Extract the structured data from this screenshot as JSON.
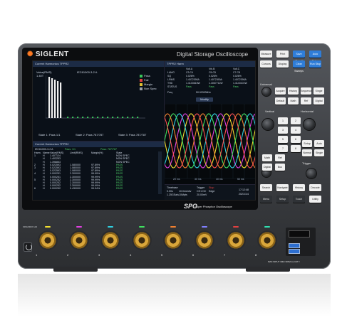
{
  "device": {
    "brand": "SIGLENT",
    "title": "Digital Storage Oscilloscope",
    "phosphor_logo": "SPO",
    "phosphor_sub": "Super Phosphor Oscilloscope",
    "model_label": "SDS2000X HD"
  },
  "screen": {
    "harmonics_panel_title": "Current Harmonics TPPR2",
    "bar_y_label": "Value(RMS)",
    "bar_y_value": "1.40T",
    "bar_chart_note": "IEC61000-3-2 A",
    "legend": [
      {
        "label": "Pass",
        "color": "#39c45a"
      },
      {
        "label": "Fail",
        "color": "#e04040"
      },
      {
        "label": "Margin",
        "color": "#e0c030"
      },
      {
        "label": "Non Spec",
        "color": "#9aa0a6"
      }
    ],
    "status": [
      "State 1: Pass 1/1",
      "State 2: Pass 787/787",
      "State 3: Pass 787/787"
    ],
    "meas_panel_title": "TPPR2 Harm",
    "meas_headers": [
      "",
      "Volt.A",
      "Vrk.B",
      "Volt.C"
    ],
    "meas_rows": [
      [
        "f.AMG",
        "C3.C4",
        "C5.C5",
        "C7.C8"
      ],
      [
        "SQ",
        "0.026%",
        "0.026%",
        "0.026%"
      ],
      [
        "I-RMS",
        "1.4072390A",
        "1.4072390A",
        "1.4072390A"
      ],
      [
        "THD",
        "1.4133616W",
        "1.4067711W",
        "1.4143101W"
      ],
      [
        "STATUS",
        "Pass",
        "Pass",
        "Pass"
      ]
    ],
    "freq_label": "Freq",
    "freq_value": "50.003036Hz",
    "modify_label": "Modify",
    "table_title": "Current Harmonics TPPR2",
    "table_sub": "IEC61000-3-2 A",
    "table_pass": "Pass: 1/1",
    "table_pass2": "Pass: 787/787",
    "table_headers": [
      "Harm.",
      "Name",
      "Value(RMS)",
      "Limit(RMS)",
      "Margin(%)",
      "State"
    ],
    "table_rows": [
      [
        "1",
        "H",
        "1.407124",
        "",
        "",
        "NON SPEC"
      ],
      [
        "",
        "H",
        "1.403253",
        "",
        "",
        "NON SPEC"
      ],
      [
        "",
        "H",
        "1.398853",
        "",
        "",
        "NON SPEC"
      ],
      [
        "2",
        "H",
        "0.022593",
        "1.080000",
        "97.89%",
        "PASS"
      ],
      [
        "3",
        "H",
        "0.022593",
        "1.080000",
        "97.89%",
        "PASS"
      ],
      [
        "",
        "H",
        "0.022593",
        "1.080000",
        "97.89%",
        "PASS"
      ],
      [
        "4",
        "H",
        "0.000251",
        "2.300000",
        "99.99%",
        "PASS"
      ],
      [
        "",
        "H",
        "0.000251",
        "2.300000",
        "99.99%",
        "PASS"
      ],
      [
        "5",
        "H",
        "0.000252",
        "2.300000",
        "99.99%",
        "PASS"
      ],
      [
        "",
        "H",
        "0.000252",
        "2.300000",
        "99.99%",
        "PASS"
      ],
      [
        "",
        "H",
        "0.000252",
        "2.300000",
        "99.99%",
        "PASS"
      ],
      [
        "6",
        "H",
        "0.000252",
        "0.430000",
        "99.94%",
        "PASS"
      ]
    ],
    "timebase_label": "Timebase",
    "timebase_value": "0.00s",
    "timebase_div": "10.0ms/div",
    "sample": "1.25GSa/s",
    "sample_pts": "10Mpts",
    "trigger_label": "Trigger",
    "trigger_state": "Stop",
    "trigger_val": "CH1 DC",
    "trigger_edge": "Edge",
    "trigger_level": "20.00mV",
    "time": "17:12:48",
    "date": "2021/1/4",
    "wave_ticks": [
      "20 ms",
      "30 ms",
      "40 ms",
      "50 ms"
    ]
  },
  "controls": {
    "row1": [
      "Measure",
      "Print",
      "Save Recall",
      "Auto Setup"
    ],
    "row2": [
      "Cursors",
      "Display",
      "Clear Sweeps",
      "Run Stop"
    ],
    "row3": [
      "Acquire",
      "History",
      "Sequence",
      "Single"
    ],
    "row4": [
      "Default",
      "Math",
      "Ref",
      "Digital"
    ],
    "vertical": "Vertical",
    "horizontal": "Horizontal",
    "universal": "Universal",
    "trigger_section": "Trigger",
    "channel_buttons": [
      "1",
      "2",
      "3",
      "4",
      "5",
      "6",
      "7",
      "8"
    ],
    "mid_buttons": [
      "Math",
      "Ref",
      "Digital",
      "Bus"
    ],
    "bottom_buttons": [
      "Search",
      "Navigate",
      "History",
      "Decode"
    ],
    "last_row": [
      "Menu",
      "Setup",
      "Touch",
      "Utility"
    ],
    "trigger_buttons": [
      "Setup",
      "Auto",
      "Normal",
      "Single"
    ]
  },
  "channels": [
    {
      "label": "1",
      "color": "#f2e030"
    },
    {
      "label": "2",
      "color": "#e040e0"
    },
    {
      "label": "3",
      "color": "#30d0e0"
    },
    {
      "label": "4",
      "color": "#40e060"
    },
    {
      "label": "5",
      "color": "#f08030"
    },
    {
      "label": "6",
      "color": "#8080ff"
    },
    {
      "label": "7",
      "color": "#e04040"
    },
    {
      "label": "8",
      "color": "#30e0b0"
    }
  ],
  "accent": "#2f7dd8",
  "warning": "MAX INPUT 1MΩ 300Vrms CAT I"
}
